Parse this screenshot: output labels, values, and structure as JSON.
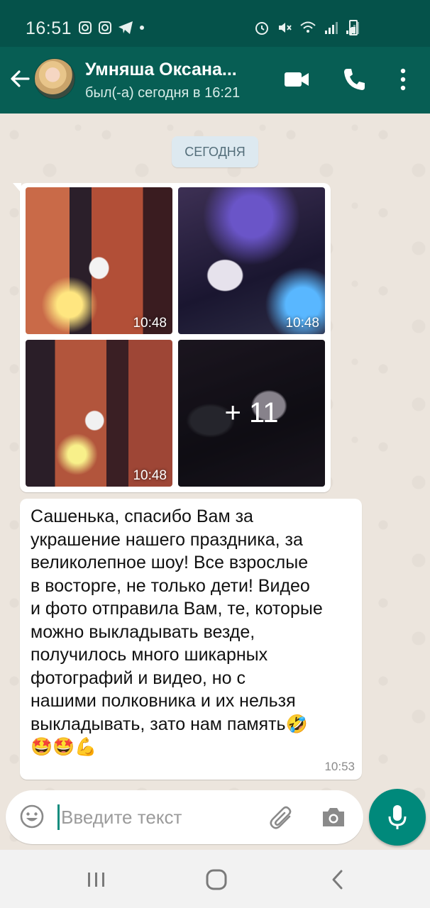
{
  "status_bar": {
    "time": "16:51",
    "icons": [
      "instagram-icon",
      "instagram-icon",
      "telegram-icon",
      "dot-icon",
      "alarm-icon",
      "mute-icon",
      "wifi-icon",
      "signal-icon",
      "signal-icon",
      "battery-icon"
    ]
  },
  "header": {
    "contact_name": "Умняша Оксана...",
    "last_seen": "был(-а) сегодня в 16:21",
    "accent": "#075e54"
  },
  "chat": {
    "date_chip": "СЕГОДНЯ",
    "album": {
      "photos": [
        {
          "time": "10:48"
        },
        {
          "time": "10:48"
        },
        {
          "time": "10:48"
        }
      ],
      "more_label": "+ 11"
    },
    "message": {
      "text": "Сашенька, спасибо Вам за\nукрашение нашего праздника, за\nвеликолепное шоу! Все взрослые\nв восторге, не только дети! Видео\nи фото отправила Вам, те, которые\nможно выкладывать везде,\nполучилось много шикарных\nфотографий и видео, но с\nнашими полковника и их нельзя\nвыкладывать, зато нам память🤣\n🤩🤩💪",
      "time": "10:53"
    }
  },
  "composer": {
    "placeholder": "Введите текст",
    "mic_color": "#00897b"
  },
  "nav": {
    "buttons": [
      "recents-icon",
      "home-icon",
      "back-icon"
    ]
  }
}
